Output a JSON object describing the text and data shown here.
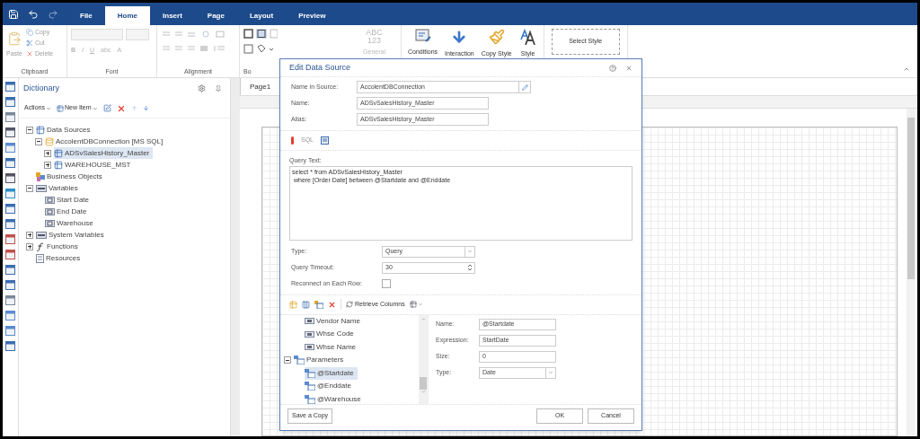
{
  "quick_access": {
    "tabs": [
      {
        "label": "File",
        "selected": false
      },
      {
        "label": "Home",
        "selected": true
      },
      {
        "label": "Insert",
        "selected": false
      },
      {
        "label": "Page",
        "selected": false
      },
      {
        "label": "Layout",
        "selected": false
      },
      {
        "label": "Preview",
        "selected": false
      }
    ]
  },
  "ribbon": {
    "clipboard": {
      "label": "Clipboard",
      "paste": {
        "label": "Paste",
        "disabled": true
      },
      "items": [
        {
          "label": "Copy",
          "disabled": true
        },
        {
          "label": "Cut",
          "disabled": true
        },
        {
          "label": "Delete",
          "disabled": true
        }
      ]
    },
    "font": {
      "label": "Font",
      "buttons": [
        "B",
        "I",
        "U",
        "abc",
        "A"
      ],
      "disabled": true
    },
    "alignment": {
      "label": "Alignment"
    },
    "borders": {
      "label": "Bo"
    },
    "format": {
      "lines": [
        "ABC",
        "123"
      ],
      "label": "General",
      "disabled": true
    },
    "actions": [
      {
        "label": "Conditions",
        "kind": "conditions"
      },
      {
        "label": "Interaction",
        "kind": "interaction"
      },
      {
        "label": "Copy Style",
        "kind": "copy-style"
      },
      {
        "label": "Style",
        "kind": "style"
      }
    ],
    "select_style": {
      "label": "Select Style"
    }
  },
  "dictionary": {
    "title": "Dictionary",
    "toolbar": {
      "actions": "Actions",
      "new_item": "New Item"
    },
    "tree": [
      {
        "label": "Data Sources",
        "kind": "datasources",
        "expanded": true,
        "selected": false,
        "children": [
          {
            "label": "AccolentDBConnection [MS SQL]",
            "kind": "connection",
            "expanded": true,
            "selected": false,
            "children": [
              {
                "label": "ADSvSalesHistory_Master",
                "kind": "table",
                "expanded": false,
                "selected": true
              },
              {
                "label": "WAREHOUSE_MST",
                "kind": "table",
                "expanded": false,
                "selected": false
              }
            ]
          }
        ]
      },
      {
        "label": "Business Objects",
        "kind": "business",
        "selected": false
      },
      {
        "label": "Variables",
        "kind": "variables",
        "expanded": true,
        "selected": false,
        "children": [
          {
            "label": "Start Date",
            "kind": "date",
            "selected": false
          },
          {
            "label": "End Date",
            "kind": "date",
            "selected": false
          },
          {
            "label": "Warehouse",
            "kind": "string",
            "selected": false
          }
        ]
      },
      {
        "label": "System Variables",
        "kind": "variables",
        "expanded": false,
        "selected": false
      },
      {
        "label": "Functions",
        "kind": "functions",
        "expanded": false,
        "selected": false
      },
      {
        "label": "Resources",
        "kind": "resources",
        "selected": false
      }
    ]
  },
  "designer": {
    "tabs": [
      {
        "label": "Page1",
        "selected": true
      }
    ]
  },
  "dialog": {
    "title": "Edit Data Source",
    "fields": [
      {
        "label": "Name in Source:",
        "value": "AccolentDBConnection",
        "kind": "edit"
      },
      {
        "label": "Name:",
        "value": "ADSvSalesHistory_Master",
        "kind": "text"
      },
      {
        "label": "Alias:",
        "value": "ADSvSalesHistory_Master",
        "kind": "text"
      }
    ],
    "query_tools": [
      {
        "kind": "error"
      },
      {
        "kind": "sql",
        "label": "SQL"
      },
      {
        "kind": "builder"
      }
    ],
    "query": {
      "label": "Query Text:",
      "lines": [
        "select * from ADSvSalesHistory_Master",
        " where [Order Date] between @Startdate and @Enddate"
      ]
    },
    "options": [
      {
        "kind": "select",
        "label": "Type:",
        "value": "Query"
      },
      {
        "kind": "spin",
        "label": "Query Timeout:",
        "value": "30"
      },
      {
        "kind": "checkbox",
        "label": "Reconnect on Each Row:",
        "checked": false
      }
    ],
    "columns_toolbar": {
      "retrieve": "Retrieve Columns"
    },
    "tree": [
      {
        "label": "Vendor Name",
        "kind": "column",
        "selected": false
      },
      {
        "label": "Whse Code",
        "kind": "column",
        "selected": false
      },
      {
        "label": "Whse Name",
        "kind": "column",
        "selected": false
      },
      {
        "label": "Parameters",
        "kind": "parameters",
        "expanded": true,
        "selected": false,
        "children": [
          {
            "label": "@Startdate",
            "kind": "parameter",
            "selected": true
          },
          {
            "label": "@Enddate",
            "kind": "parameter",
            "selected": false
          },
          {
            "label": "@Warehouse",
            "kind": "parameter",
            "selected": false
          }
        ]
      }
    ],
    "properties": [
      {
        "kind": "text",
        "label": "Name:",
        "value": "@Startdate"
      },
      {
        "kind": "text",
        "label": "Expression:",
        "value": "StartDate"
      },
      {
        "kind": "text",
        "label": "Size:",
        "value": "0"
      },
      {
        "kind": "select",
        "label": "Type:",
        "value": "Date"
      }
    ],
    "buttons": [
      {
        "label": "Save a Copy",
        "kind": "left"
      },
      {
        "label": "OK",
        "kind": "right"
      },
      {
        "label": "Cancel",
        "kind": "right"
      }
    ]
  }
}
